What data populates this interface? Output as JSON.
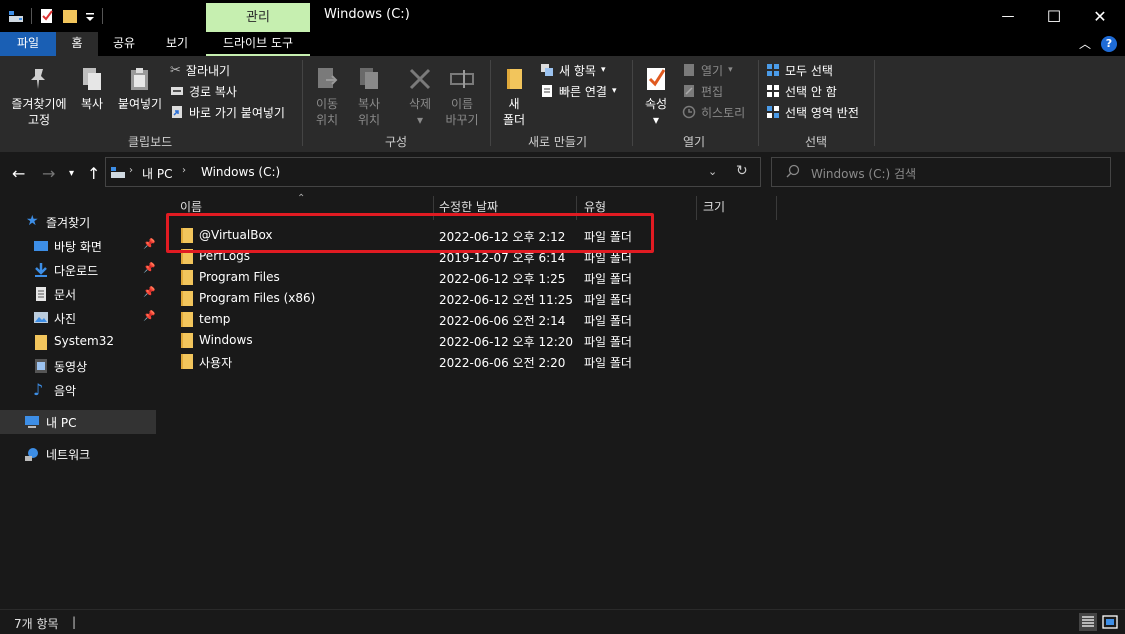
{
  "titlebar": {
    "context_tab": "관리",
    "title": "Windows (C:)",
    "minimize": "—",
    "maximize": "☐",
    "close": "✕"
  },
  "tabs": {
    "file": "파일",
    "home": "홈",
    "share": "공유",
    "view": "보기",
    "drive_tools": "드라이브 도구",
    "help": "?"
  },
  "ribbon": {
    "clipboard": {
      "pin_line1": "즐겨찾기에",
      "pin_line2": "고정",
      "copy": "복사",
      "paste": "붙여넣기",
      "cut": "잘라내기",
      "copy_path": "경로 복사",
      "paste_shortcut": "바로 가기 붙여넣기",
      "label": "클립보드"
    },
    "organize": {
      "move_line1": "이동",
      "move_line2": "위치",
      "copyto_line1": "복사",
      "copyto_line2": "위치",
      "delete": "삭제",
      "rename_line1": "이름",
      "rename_line2": "바꾸기",
      "label": "구성"
    },
    "new": {
      "folder_line1": "새",
      "folder_line2": "폴더",
      "new_item": "새 항목",
      "easy_access": "빠른 연결",
      "label": "새로 만들기"
    },
    "open": {
      "properties": "속성",
      "open": "열기",
      "edit": "편집",
      "history": "히스토리",
      "label": "열기"
    },
    "select": {
      "select_all": "모두 선택",
      "select_none": "선택 안 함",
      "invert": "선택 영역 반전",
      "label": "선택"
    }
  },
  "address": {
    "crumb1": "내 PC",
    "crumb2": "Windows (C:)",
    "search_placeholder": "Windows (C:) 검색"
  },
  "sidebar": {
    "quick_access": "즐겨찾기",
    "items": [
      {
        "label": "바탕 화면",
        "pinned": true
      },
      {
        "label": "다운로드",
        "pinned": true
      },
      {
        "label": "문서",
        "pinned": true
      },
      {
        "label": "사진",
        "pinned": true
      },
      {
        "label": "System32",
        "pinned": false
      },
      {
        "label": "동영상",
        "pinned": false
      },
      {
        "label": "음악",
        "pinned": false
      }
    ],
    "this_pc": "내 PC",
    "network": "네트워크"
  },
  "filelist": {
    "columns": {
      "name": "이름",
      "modified": "수정한 날짜",
      "type": "유형",
      "size": "크기"
    },
    "rows": [
      {
        "name": "@VirtualBox",
        "modified": "2022-06-12 오후 2:12",
        "type": "파일 폴더"
      },
      {
        "name": "PerfLogs",
        "modified": "2019-12-07 오후 6:14",
        "type": "파일 폴더"
      },
      {
        "name": "Program Files",
        "modified": "2022-06-12 오후 1:25",
        "type": "파일 폴더"
      },
      {
        "name": "Program Files (x86)",
        "modified": "2022-06-12 오전 11:25",
        "type": "파일 폴더"
      },
      {
        "name": "temp",
        "modified": "2022-06-06 오전 2:14",
        "type": "파일 폴더"
      },
      {
        "name": "Windows",
        "modified": "2022-06-12 오후 12:20",
        "type": "파일 폴더"
      },
      {
        "name": "사용자",
        "modified": "2022-06-06 오전 2:20",
        "type": "파일 폴더"
      }
    ]
  },
  "status": {
    "count": "7개 항목",
    "sep": "|"
  },
  "colors": {
    "manage_tab": "#c6efb0",
    "file_tab": "#1a5fb4",
    "highlight": "#e11b22",
    "folder": "#f2c55c"
  }
}
